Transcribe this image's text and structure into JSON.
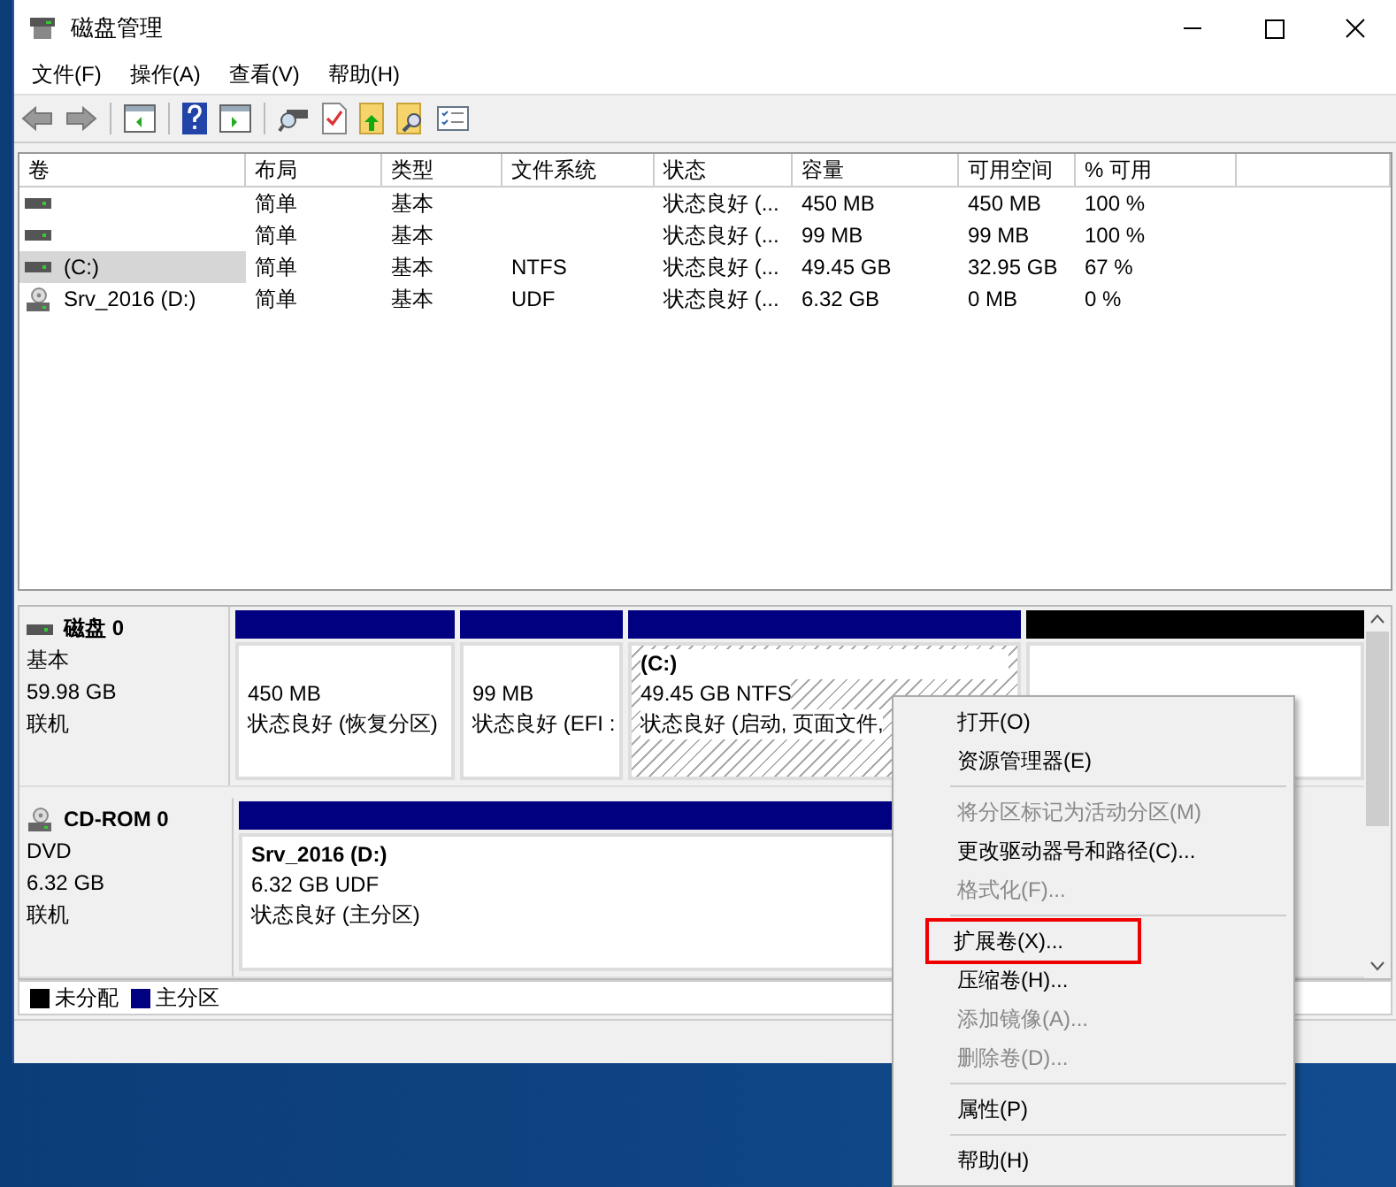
{
  "window": {
    "title": "磁盘管理"
  },
  "menu": [
    "文件(F)",
    "操作(A)",
    "查看(V)",
    "帮助(H)"
  ],
  "table": {
    "columns": [
      "卷",
      "布局",
      "类型",
      "文件系统",
      "状态",
      "容量",
      "可用空间",
      "% 可用"
    ],
    "rows": [
      {
        "kind": "disk",
        "cells": [
          "",
          "简单",
          "基本",
          "",
          "状态良好 (...",
          "450 MB",
          "450 MB",
          "100 %"
        ],
        "selected": false
      },
      {
        "kind": "disk",
        "cells": [
          "",
          "简单",
          "基本",
          "",
          "状态良好 (...",
          "99 MB",
          "99 MB",
          "100 %"
        ],
        "selected": false
      },
      {
        "kind": "disk",
        "cells": [
          "(C:)",
          "简单",
          "基本",
          "NTFS",
          "状态良好 (...",
          "49.45 GB",
          "32.95 GB",
          "67 %"
        ],
        "selected": true
      },
      {
        "kind": "cd",
        "cells": [
          "Srv_2016 (D:)",
          "简单",
          "基本",
          "UDF",
          "状态良好 (...",
          "6.32 GB",
          "0 MB",
          "0 %"
        ],
        "selected": false
      }
    ]
  },
  "disks": [
    {
      "kind": "disk",
      "name": "磁盘 0",
      "type": "基本",
      "size": "59.98 GB",
      "status": "联机",
      "partitions": [
        {
          "kind": "primary",
          "selected": false,
          "size": "450 MB",
          "status": "状态良好 (恢复分区)"
        },
        {
          "kind": "primary",
          "selected": false,
          "size": "99 MB",
          "status": "状态良好 (EFI :"
        },
        {
          "kind": "primary",
          "selected": true,
          "label": "(C:)",
          "size": "49.45 GB NTFS",
          "status": "状态良好 (启动, 页面文件,"
        },
        {
          "kind": "unallocated",
          "selected": false
        }
      ]
    },
    {
      "kind": "cd",
      "name": "CD-ROM 0",
      "type": "DVD",
      "size": "6.32 GB",
      "status": "联机",
      "partitions": [
        {
          "kind": "primary",
          "selected": false,
          "label": "Srv_2016  (D:)",
          "size": "6.32 GB UDF",
          "status": "状态良好 (主分区)"
        }
      ]
    }
  ],
  "legend": [
    {
      "label": "未分配",
      "color": "#000000"
    },
    {
      "label": "主分区",
      "color": "#000080"
    }
  ],
  "context_menu": [
    {
      "kind": "item",
      "label": "打开(O)",
      "disabled": false,
      "highlighted": false
    },
    {
      "kind": "item",
      "label": "资源管理器(E)",
      "disabled": false,
      "highlighted": false
    },
    {
      "kind": "separator"
    },
    {
      "kind": "item",
      "label": "将分区标记为活动分区(M)",
      "disabled": true,
      "highlighted": false
    },
    {
      "kind": "item",
      "label": "更改驱动器号和路径(C)...",
      "disabled": false,
      "highlighted": false
    },
    {
      "kind": "item",
      "label": "格式化(F)...",
      "disabled": true,
      "highlighted": false
    },
    {
      "kind": "separator"
    },
    {
      "kind": "item",
      "label": "扩展卷(X)...",
      "disabled": false,
      "highlighted": true
    },
    {
      "kind": "item",
      "label": "压缩卷(H)...",
      "disabled": false,
      "highlighted": false
    },
    {
      "kind": "item",
      "label": "添加镜像(A)...",
      "disabled": true,
      "highlighted": false
    },
    {
      "kind": "item",
      "label": "删除卷(D)...",
      "disabled": true,
      "highlighted": false
    },
    {
      "kind": "separator"
    },
    {
      "kind": "item",
      "label": "属性(P)",
      "disabled": false,
      "highlighted": false
    },
    {
      "kind": "separator"
    },
    {
      "kind": "item",
      "label": "帮助(H)",
      "disabled": false,
      "highlighted": false
    }
  ]
}
